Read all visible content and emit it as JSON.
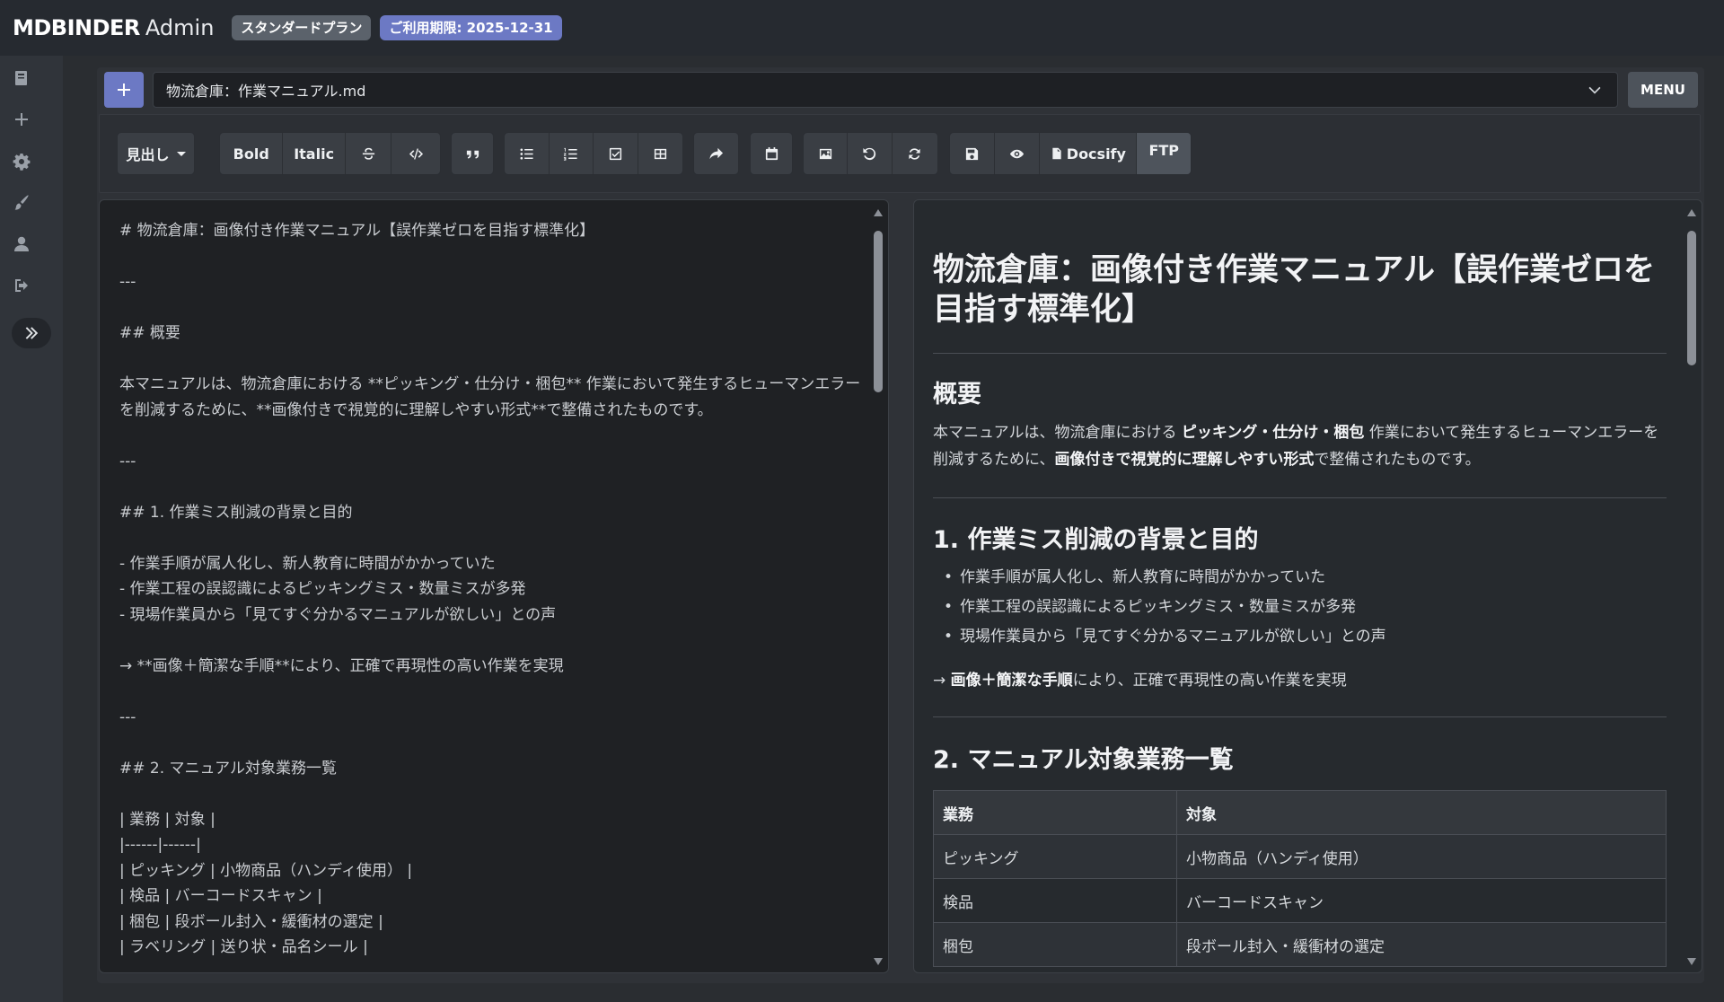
{
  "header": {
    "brand_bold": "MDBINDER",
    "brand_light": "Admin",
    "plan_badge": "スタンダードプラン",
    "expire_badge": "ご利用期限: 2025-12-31"
  },
  "sidebar": {
    "icons": [
      "book-icon",
      "plus-icon",
      "gear-icon",
      "brush-icon",
      "user-icon",
      "logout-icon"
    ],
    "expand_icon": "double-chevron-right-icon"
  },
  "file": {
    "add_icon": "plus-icon",
    "selected": "物流倉庫：作業マニュアル.md",
    "menu_label": "MENU"
  },
  "toolbar": {
    "heading_label": "見出し",
    "bold_label": "Bold",
    "italic_label": "Italic",
    "docsify_label": "Docsify",
    "ftp_label": "FTP",
    "icons": [
      "strikethrough-icon",
      "code-icon",
      "quote-icon",
      "bullet-list-icon",
      "numbered-list-icon",
      "checkbox-icon",
      "table-icon",
      "share-icon",
      "calendar-icon",
      "image-icon",
      "undo-icon",
      "sync-icon",
      "save-icon",
      "eye-icon",
      "file-icon"
    ]
  },
  "editor": {
    "lines": [
      "# 物流倉庫：画像付き作業マニュアル【誤作業ゼロを目指す標準化】",
      "",
      "---",
      "",
      "## 概要",
      "",
      "本マニュアルは、物流倉庫における **ピッキング・仕分け・梱包** 作業において発生するヒューマンエラーを削減するために、**画像付きで視覚的に理解しやすい形式**で整備されたものです。",
      "",
      "---",
      "",
      "## 1. 作業ミス削減の背景と目的",
      "",
      "- 作業手順が属人化し、新人教育に時間がかかっていた",
      "- 作業工程の誤認識によるピッキングミス・数量ミスが多発",
      "- 現場作業員から「見てすぐ分かるマニュアルが欲しい」との声",
      "",
      "→ **画像＋簡潔な手順**により、正確で再現性の高い作業を実現",
      "",
      "---",
      "",
      "## 2. マニュアル対象業務一覧",
      "",
      "| 業務 | 対象 |",
      "|------|------|",
      "| ピッキング | 小物商品（ハンディ使用） |",
      "| 検品 | バーコードスキャン |",
      "| 梱包 | 段ボール封入・緩衝材の選定 |",
      "| ラベリング | 送り状・品名シール |"
    ]
  },
  "preview": {
    "title": "物流倉庫：画像付き作業マニュアル【誤作業ゼロを目指す標準化】",
    "overview_heading": "概要",
    "overview_pre": "本マニュアルは、物流倉庫における ",
    "overview_bold1": "ピッキング・仕分け・梱包",
    "overview_mid": " 作業において発生するヒューマンエラーを削減するために、",
    "overview_bold2": "画像付きで視覚的に理解しやすい形式",
    "overview_post": "で整備されたものです。",
    "section1_heading": "1. 作業ミス削減の背景と目的",
    "section1_items": [
      "作業手順が属人化し、新人教育に時間がかかっていた",
      "作業工程の誤認識によるピッキングミス・数量ミスが多発",
      "現場作業員から「見てすぐ分かるマニュアルが欲しい」との声"
    ],
    "arrow_pre": "→ ",
    "arrow_bold": "画像＋簡潔な手順",
    "arrow_post": "により、正確で再現性の高い作業を実現",
    "section2_heading": "2. マニュアル対象業務一覧",
    "table_headers": [
      "業務",
      "対象"
    ],
    "table_rows": [
      [
        "ピッキング",
        "小物商品（ハンディ使用）"
      ],
      [
        "検品",
        "バーコードスキャン"
      ],
      [
        "梱包",
        "段ボール封入・緩衝材の選定"
      ]
    ]
  }
}
